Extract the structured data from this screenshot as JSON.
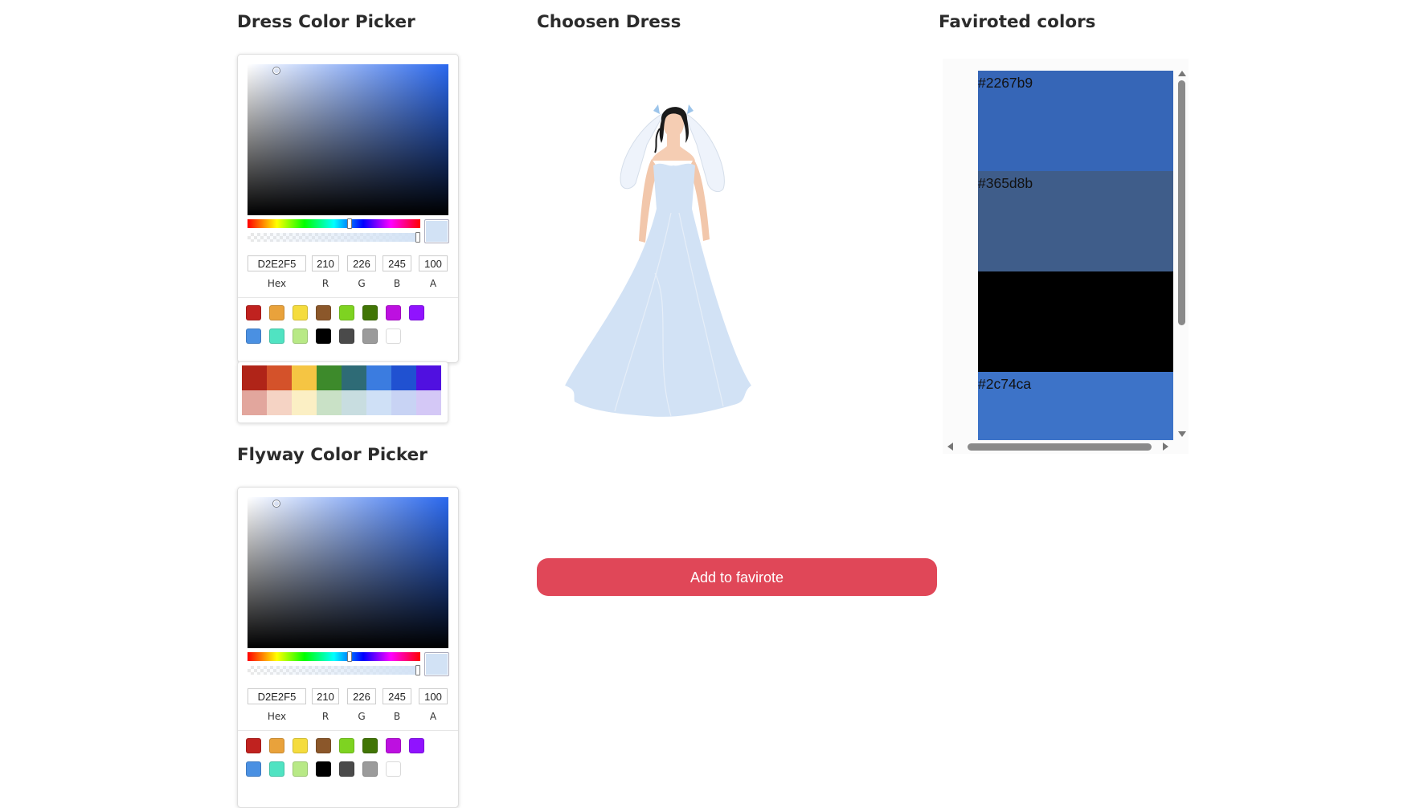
{
  "headings": {
    "dress_picker": "Dress Color Picker",
    "chosen_dress": "Choosen Dress",
    "favorited_colors": "Faviroted colors",
    "flyway_picker": "Flyway Color Picker"
  },
  "dress_picker": {
    "hex": "D2E2F5",
    "r": "210",
    "g": "226",
    "b": "245",
    "a": "100",
    "labels": {
      "hex": "Hex",
      "r": "R",
      "g": "G",
      "b": "B",
      "a": "A"
    },
    "current_color": "#D2E2F5",
    "hue_color": "#2a68ee"
  },
  "flyway_picker": {
    "hex": "D2E2F5",
    "r": "210",
    "g": "226",
    "b": "245",
    "a": "100",
    "labels": {
      "hex": "Hex",
      "r": "R",
      "g": "G",
      "b": "B",
      "a": "A"
    },
    "current_color": "#D2E2F5",
    "hue_color": "#2a68ee"
  },
  "preset_colors": [
    "#c0221f",
    "#e9a23b",
    "#f5dc3d",
    "#8b572a",
    "#7ed321",
    "#417505",
    "#bd10e0",
    "#9013fe",
    "#4a90e2",
    "#50e3c2",
    "#b8e986",
    "#000000",
    "#4a4a4a",
    "#9b9b9b",
    "#ffffff"
  ],
  "palette": {
    "top_row": [
      "#b02418",
      "#d4522a",
      "#f5c543",
      "#3d8a2b",
      "#2e6b76",
      "#3b7ce0",
      "#2051d1",
      "#5010e0"
    ],
    "bottom_row": [
      "#e2a69d",
      "#f5d3c4",
      "#fbefc4",
      "#c9e1c6",
      "#c8dde0",
      "#cfe0f6",
      "#c8d3f4",
      "#d4c8f6"
    ]
  },
  "dress": {
    "color": "#D2E2F5"
  },
  "add_button": {
    "label": "Add to favirote",
    "color": "#e04758"
  },
  "favorites": [
    {
      "label": "#2267b9",
      "color": "#3666b7"
    },
    {
      "label": "#365d8b",
      "color": "#3f5d8a"
    },
    {
      "label": "",
      "color": "#000000"
    },
    {
      "label": "#2c74ca",
      "color": "#3d73c8"
    }
  ]
}
